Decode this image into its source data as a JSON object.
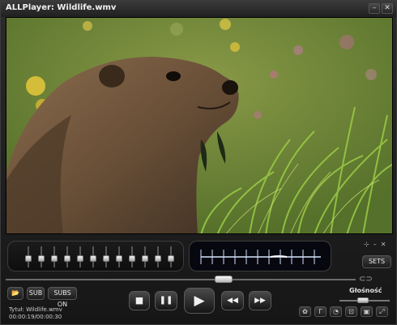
{
  "window": {
    "title": "ALLPlayer: Wildlife.wmv",
    "minimize_icon": "minimize-icon",
    "close_icon": "close-icon"
  },
  "equalizer": {
    "band_count": 12,
    "levels": [
      0.4,
      0.4,
      0.4,
      0.4,
      0.4,
      0.4,
      0.4,
      0.4,
      0.4,
      0.4,
      0.4,
      0.4
    ]
  },
  "buttons": {
    "sets": "SETS",
    "sub": "SUB",
    "subs_on": "SUBS ON"
  },
  "seek": {
    "position": 0.63
  },
  "file_info": {
    "title_line": "Tytuł: Wildlife.wmv",
    "time_line": "00:00:19/00:00:30"
  },
  "transport": {
    "stop": "■",
    "pause": "❚❚",
    "play": "▶",
    "rewind": "◀◀",
    "forward": "▶▶"
  },
  "volume": {
    "label": "Głośność",
    "level": 0.45
  },
  "colors": {
    "accent": "#ffffff",
    "panel": "#1b1b1b",
    "visualizer_bg": "#07070f"
  }
}
